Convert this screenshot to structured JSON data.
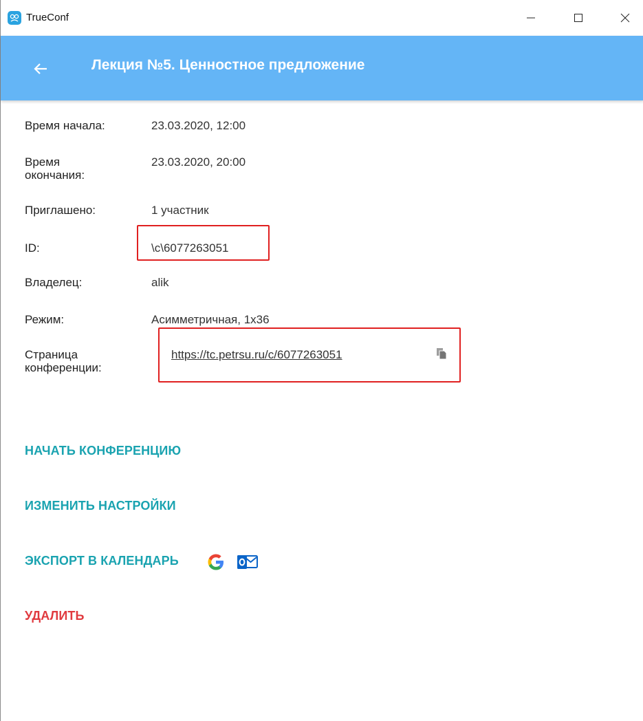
{
  "window": {
    "title": "TrueConf",
    "icons": {
      "app": "trueconf-logo-icon",
      "minimize": "minimize-icon",
      "maximize": "maximize-icon",
      "close": "close-icon"
    }
  },
  "header": {
    "title": "Лекция №5. Ценностное предложение",
    "back_icon": "arrow-left-icon",
    "color": "#64b5f6"
  },
  "details": {
    "start_time": {
      "label": "Время начала:",
      "value": "23.03.2020, 12:00"
    },
    "end_time": {
      "label_line1": "Время",
      "label_line2": "окончания:",
      "value": "23.03.2020, 20:00"
    },
    "invited": {
      "label": "Приглашено:",
      "value": "1 участник"
    },
    "id": {
      "label": "ID:",
      "value": "\\c\\6077263051"
    },
    "owner": {
      "label": "Владелец:",
      "value": "alik"
    },
    "mode": {
      "label": "Режим:",
      "value": "Асимметричная, 1x36"
    },
    "page": {
      "label_line1": "Страница",
      "label_line2": "конференции:",
      "value": "https://tc.petrsu.ru/c/6077263051",
      "copy_icon": "copy-icon"
    }
  },
  "actions": {
    "start": "НАЧАТЬ КОНФЕРЕНЦИЮ",
    "edit": "ИЗМЕНИТЬ НАСТРОЙКИ",
    "export": "ЭКСПОРТ В КАЛЕНДАРЬ",
    "export_icons": [
      "google-calendar-icon",
      "outlook-icon"
    ],
    "delete": "УДАЛИТЬ"
  },
  "colors": {
    "accent": "#1aa3b0",
    "danger": "#e0393e",
    "highlight": "#e02020"
  }
}
